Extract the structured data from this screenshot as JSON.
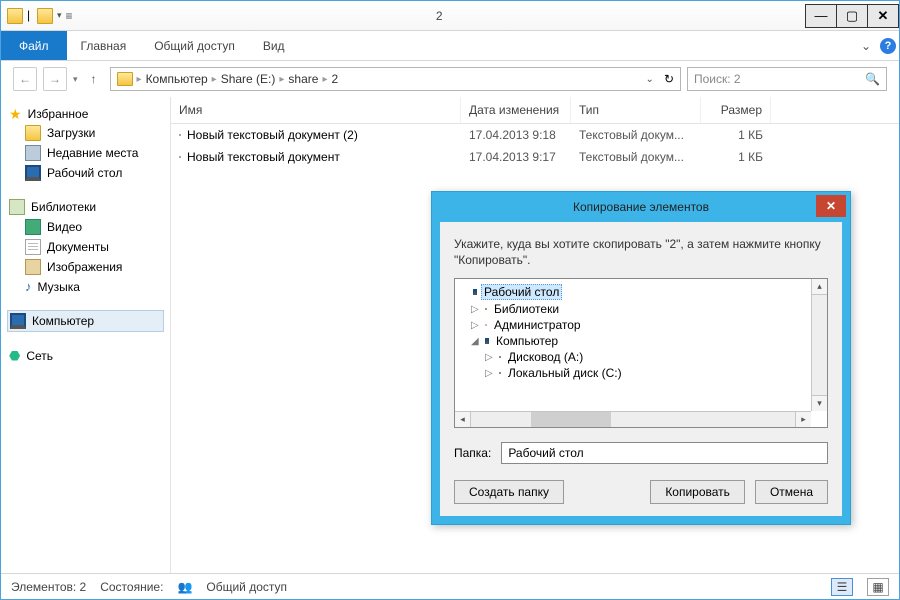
{
  "window": {
    "title": "2"
  },
  "ribbon": {
    "file": "Файл",
    "tabs": [
      "Главная",
      "Общий доступ",
      "Вид"
    ]
  },
  "address": {
    "crumbs": [
      "Компьютер",
      "Share (E:)",
      "share",
      "2"
    ]
  },
  "search": {
    "placeholder": "Поиск: 2"
  },
  "sidebar": {
    "favorites": {
      "label": "Избранное",
      "items": [
        "Загрузки",
        "Недавние места",
        "Рабочий стол"
      ]
    },
    "libraries": {
      "label": "Библиотеки",
      "items": [
        "Видео",
        "Документы",
        "Изображения",
        "Музыка"
      ]
    },
    "computer": {
      "label": "Компьютер"
    },
    "network": {
      "label": "Сеть"
    }
  },
  "columns": {
    "name": "Имя",
    "date": "Дата изменения",
    "type": "Тип",
    "size": "Размер"
  },
  "rows": [
    {
      "name": "Новый текстовый документ (2)",
      "date": "17.04.2013 9:18",
      "type": "Текстовый докум...",
      "size": "1 КБ"
    },
    {
      "name": "Новый текстовый документ",
      "date": "17.04.2013 9:17",
      "type": "Текстовый докум...",
      "size": "1 КБ"
    }
  ],
  "status": {
    "count_label": "Элементов: 2",
    "state_label": "Состояние:",
    "state_value": "Общий доступ"
  },
  "dialog": {
    "title": "Копирование элементов",
    "instruction": "Укажите, куда вы хотите скопировать \"2\", а затем нажмите кнопку \"Копировать\".",
    "tree": [
      {
        "label": "Рабочий стол",
        "indent": 0,
        "selected": true,
        "expander": ""
      },
      {
        "label": "Библиотеки",
        "indent": 1,
        "expander": "▷"
      },
      {
        "label": "Администратор",
        "indent": 1,
        "expander": "▷"
      },
      {
        "label": "Компьютер",
        "indent": 1,
        "expander": "◢"
      },
      {
        "label": "Дисковод (A:)",
        "indent": 2,
        "expander": "▷"
      },
      {
        "label": "Локальный диск (C:)",
        "indent": 2,
        "expander": "▷"
      }
    ],
    "folder_label": "Папка:",
    "folder_value": "Рабочий стол",
    "buttons": {
      "create": "Создать папку",
      "copy": "Копировать",
      "cancel": "Отмена"
    }
  }
}
